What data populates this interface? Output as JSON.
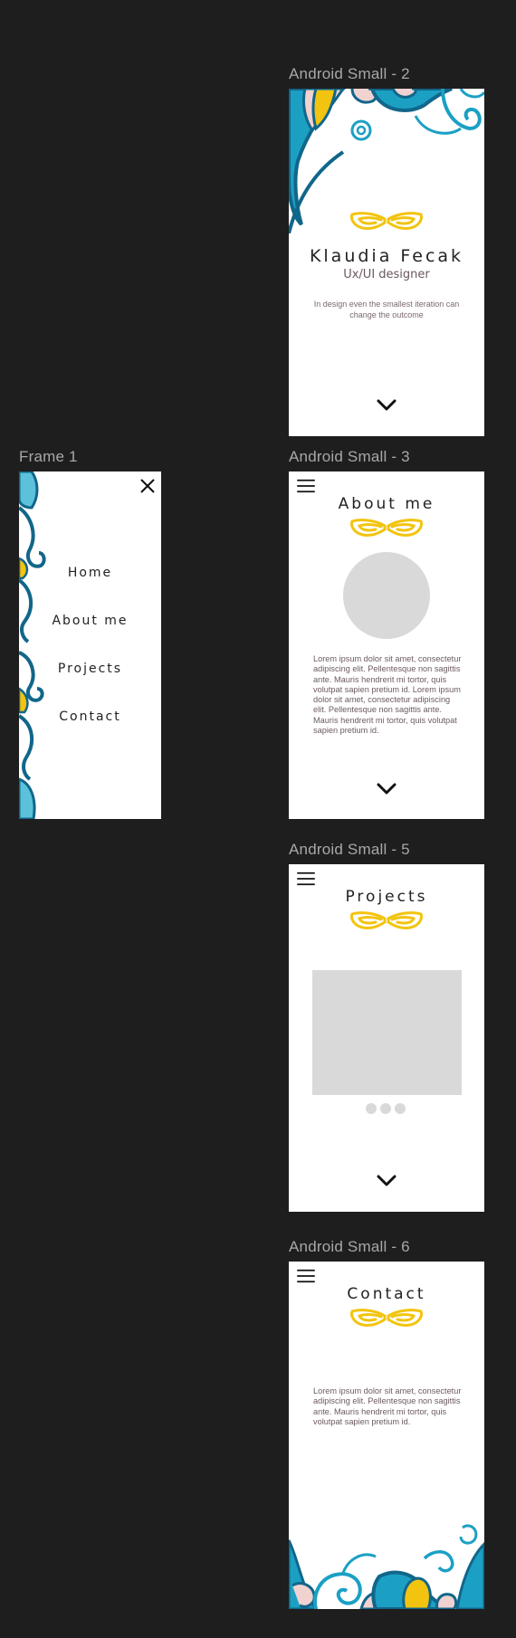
{
  "canvas": {
    "background": "#1e1e1e"
  },
  "colors": {
    "yellow": "#f2c40f",
    "blue": "#1ba0c4",
    "darkblue": "#11668a",
    "pink": "#f0d2d0"
  },
  "frames": {
    "home": {
      "label": "Android Small - 2",
      "name": "Klaudia Fecak",
      "role": "Ux/UI designer",
      "tagline": "In design even the smallest iteration can change the outcome",
      "icons": [
        "ornament-icon",
        "chevron-down-icon"
      ]
    },
    "menu": {
      "label": "Frame 1",
      "items": [
        "Home",
        "About me",
        "Projects",
        "Contact"
      ],
      "icons": [
        "close-icon"
      ]
    },
    "about": {
      "label": "Android Small - 3",
      "title": "About me",
      "body": "Lorem ipsum dolor sit amet, consectetur adipiscing elit. Pellentesque non sagittis ante. Mauris hendrerit mi tortor, quis volutpat sapien pretium id. Lorem ipsum dolor sit amet, consectetur adipiscing elit. Pellentesque non sagittis ante. Mauris hendrerit mi tortor, quis volutpat sapien pretium id.",
      "icons": [
        "hamburger-icon",
        "ornament-icon",
        "chevron-down-icon"
      ]
    },
    "projects": {
      "label": "Android Small - 5",
      "title": "Projects",
      "carousel_dots": 3,
      "icons": [
        "hamburger-icon",
        "ornament-icon",
        "chevron-down-icon"
      ]
    },
    "contact": {
      "label": "Android Small - 6",
      "title": "Contact",
      "body": "Lorem ipsum dolor sit amet, consectetur adipiscing elit. Pellentesque non sagittis ante. Mauris hendrerit mi tortor, quis volutpat sapien pretium id.",
      "icons": [
        "hamburger-icon",
        "ornament-icon"
      ]
    }
  }
}
